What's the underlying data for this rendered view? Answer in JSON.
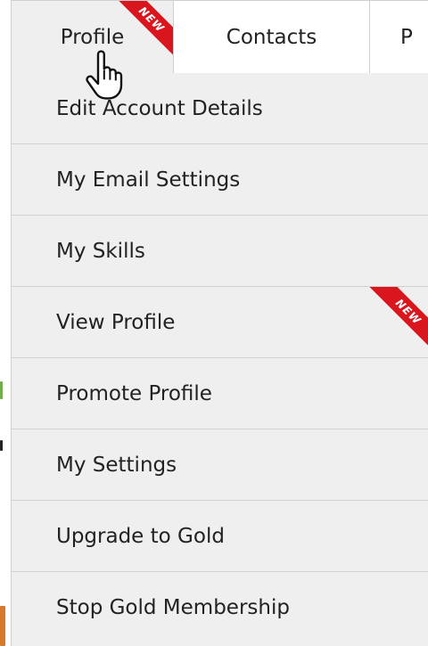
{
  "tabs": [
    {
      "label": "Profile",
      "badge": "NEW",
      "active": true
    },
    {
      "label": "Contacts"
    },
    {
      "label": "P"
    }
  ],
  "menu": {
    "items": [
      {
        "label": "Edit Account Details"
      },
      {
        "label": "My Email Settings"
      },
      {
        "label": "My Skills"
      },
      {
        "label": "View Profile",
        "badge": "NEW"
      },
      {
        "label": "Promote Profile"
      },
      {
        "label": "My Settings"
      },
      {
        "label": "Upgrade to Gold"
      },
      {
        "label": "Stop Gold Membership"
      }
    ]
  },
  "colors": {
    "badge": "#d9161d",
    "menu_background": "#efefef",
    "divider": "#cfcfcf",
    "text": "#222222"
  },
  "icons": {
    "cursor": "hand-pointer-icon"
  }
}
